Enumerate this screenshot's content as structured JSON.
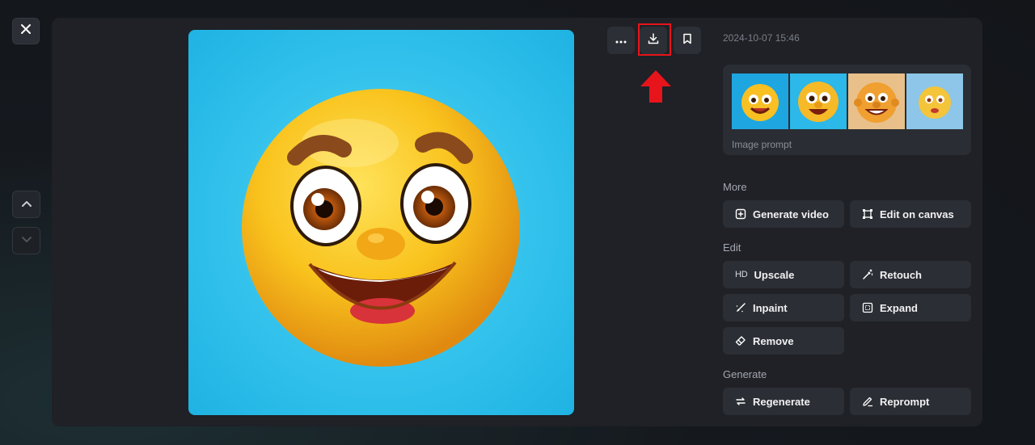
{
  "timestamp": "2024-10-07 15:46",
  "prompt_label": "Image prompt",
  "sections": {
    "more": "More",
    "edit": "Edit",
    "generate": "Generate"
  },
  "buttons": {
    "generate_video": "Generate video",
    "edit_on_canvas": "Edit on canvas",
    "upscale": "Upscale",
    "upscale_badge": "HD",
    "retouch": "Retouch",
    "inpaint": "Inpaint",
    "expand": "Expand",
    "remove": "Remove",
    "regenerate": "Regenerate",
    "reprompt": "Reprompt"
  },
  "icons": {
    "close": "close-icon",
    "up": "chevron-up-icon",
    "down": "chevron-down-icon",
    "more": "more-icon",
    "download": "download-icon",
    "bookmark": "bookmark-icon"
  },
  "colors": {
    "highlight": "#e8141b",
    "panel": "#1f2126",
    "button": "#2b2e34",
    "image_bg": "#33c2ec"
  }
}
